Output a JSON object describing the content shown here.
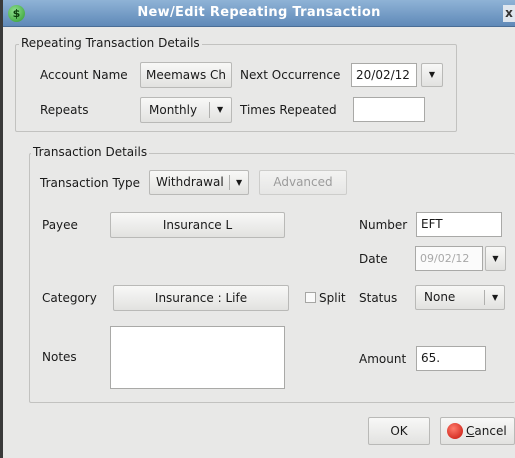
{
  "window": {
    "title": "New/Edit Repeating Transaction",
    "app_icon": "$",
    "close_glyph": "x"
  },
  "repeating": {
    "group_label": "Repeating Transaction Details",
    "account_name_label": "Account Name",
    "account_name_value": "Meemaws Ch",
    "next_occurrence_label": "Next Occurrence",
    "next_occurrence_value": "20/02/12",
    "repeats_label": "Repeats",
    "repeats_value": "Monthly",
    "times_repeated_label": "Times Repeated",
    "times_repeated_value": ""
  },
  "transaction": {
    "group_label": "Transaction Details",
    "type_label": "Transaction Type",
    "type_value": "Withdrawal",
    "advanced_label": "Advanced",
    "payee_label": "Payee",
    "payee_value": "Insurance L",
    "number_label": "Number",
    "number_value": "EFT",
    "date_label": "Date",
    "date_value": "09/02/12",
    "category_label": "Category",
    "category_value": "Insurance : Life",
    "split_label": "Split",
    "status_label": "Status",
    "status_value": "None",
    "notes_label": "Notes",
    "notes_value": "",
    "amount_label": "Amount",
    "amount_value": "65."
  },
  "footer": {
    "ok_label": "OK",
    "cancel_label_first": "C",
    "cancel_label_rest": "ancel"
  },
  "icons": {
    "dropdown": "▼"
  }
}
